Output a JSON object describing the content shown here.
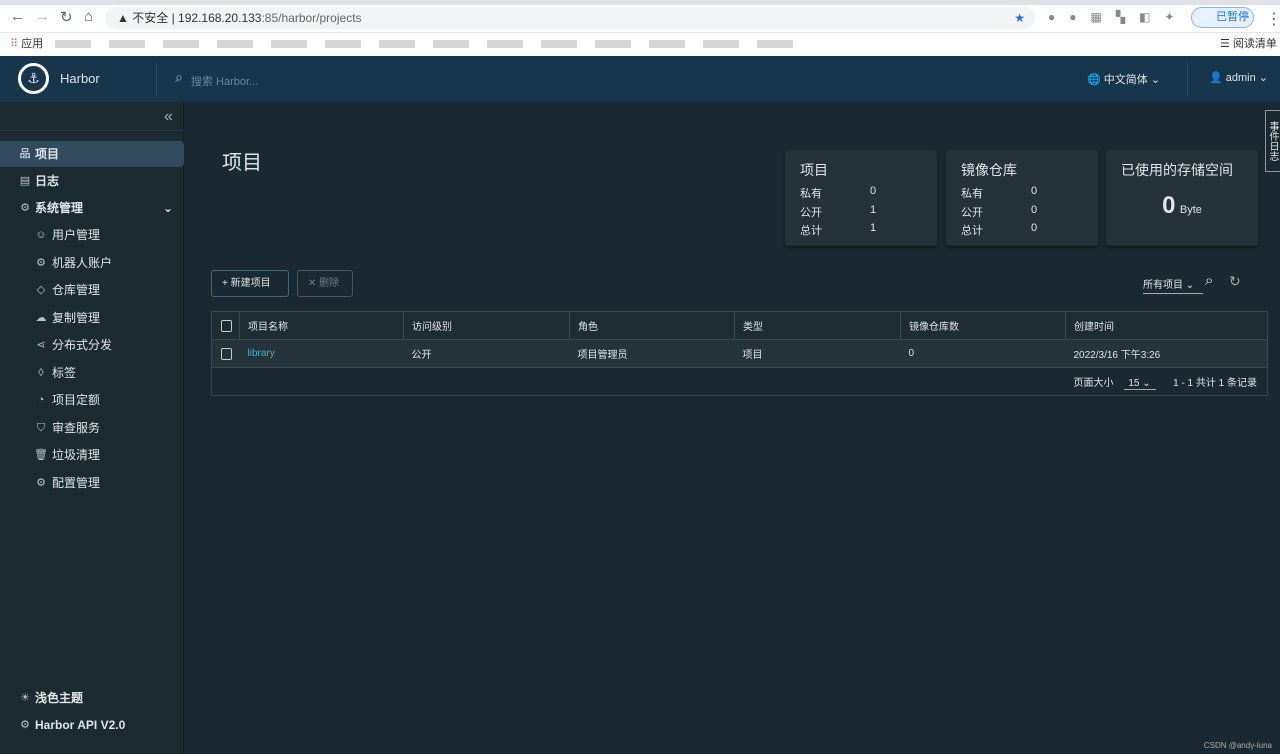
{
  "browser": {
    "security": "不安全",
    "url_host": "192.168.20.133",
    "url_rest": ":85/harbor/projects",
    "apps": "应用",
    "reading_list": "阅读清单",
    "profile": "已暂停"
  },
  "header": {
    "brand": "Harbor",
    "search_placeholder": "搜索 Harbor...",
    "language": "中文简体",
    "user": "admin"
  },
  "sidebar": {
    "items": [
      {
        "label": "项目"
      },
      {
        "label": "日志"
      },
      {
        "label": "系统管理"
      }
    ],
    "sub_items": [
      {
        "label": "用户管理"
      },
      {
        "label": "机器人账户"
      },
      {
        "label": "仓库管理"
      },
      {
        "label": "复制管理"
      },
      {
        "label": "分布式分发"
      },
      {
        "label": "标签"
      },
      {
        "label": "项目定额"
      },
      {
        "label": "审查服务"
      },
      {
        "label": "垃圾清理"
      },
      {
        "label": "配置管理"
      }
    ],
    "theme": "浅色主题",
    "api": "Harbor API V2.0"
  },
  "page": {
    "title": "项目",
    "side_tab": "事件日志"
  },
  "cards": {
    "projects": {
      "title": "项目",
      "private_label": "私有",
      "private": "0",
      "public_label": "公开",
      "public": "1",
      "total_label": "总计",
      "total": "1"
    },
    "repos": {
      "title": "镜像仓库",
      "private_label": "私有",
      "private": "0",
      "public_label": "公开",
      "public": "0",
      "total_label": "总计",
      "total": "0"
    },
    "storage": {
      "title": "已使用的存储空间",
      "value": "0",
      "unit": "Byte"
    }
  },
  "toolbar": {
    "new_project": "新建项目",
    "delete": "删除",
    "filter": "所有项目"
  },
  "table": {
    "headers": [
      "项目名称",
      "访问级别",
      "角色",
      "类型",
      "镜像仓库数",
      "创建时间"
    ],
    "rows": [
      [
        "library",
        "公开",
        "项目管理员",
        "项目",
        "0",
        "2022/3/16 下午3:26"
      ]
    ],
    "page_size_label": "页面大小",
    "page_size": "15",
    "summary": "1 - 1 共计 1 条记录"
  },
  "watermark": "CSDN @andy-luna"
}
